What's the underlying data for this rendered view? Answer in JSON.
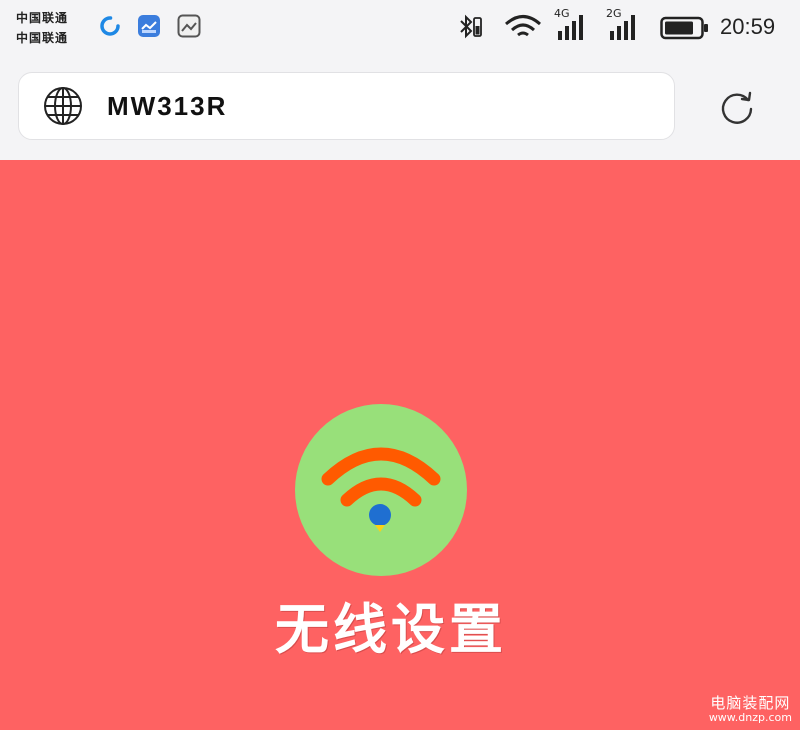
{
  "status_bar": {
    "carrier_lines": [
      "中国联通",
      "中国联通"
    ],
    "notification_icons": [
      "loading-circle-icon",
      "gallery-app-icon",
      "image-app-icon"
    ],
    "network_labels": [
      "4G",
      "2G"
    ],
    "time": "20:59"
  },
  "address_bar": {
    "url": "MW313R"
  },
  "page": {
    "background_color": "#fe6262",
    "logo_circle_color": "#98e07a",
    "wifi_arc_color": "#ff5a00",
    "wifi_dot_color": "#1f6fd1",
    "title": "无线设置"
  },
  "watermark": {
    "title": "电脑装配网",
    "url": "www.dnzp.com"
  }
}
